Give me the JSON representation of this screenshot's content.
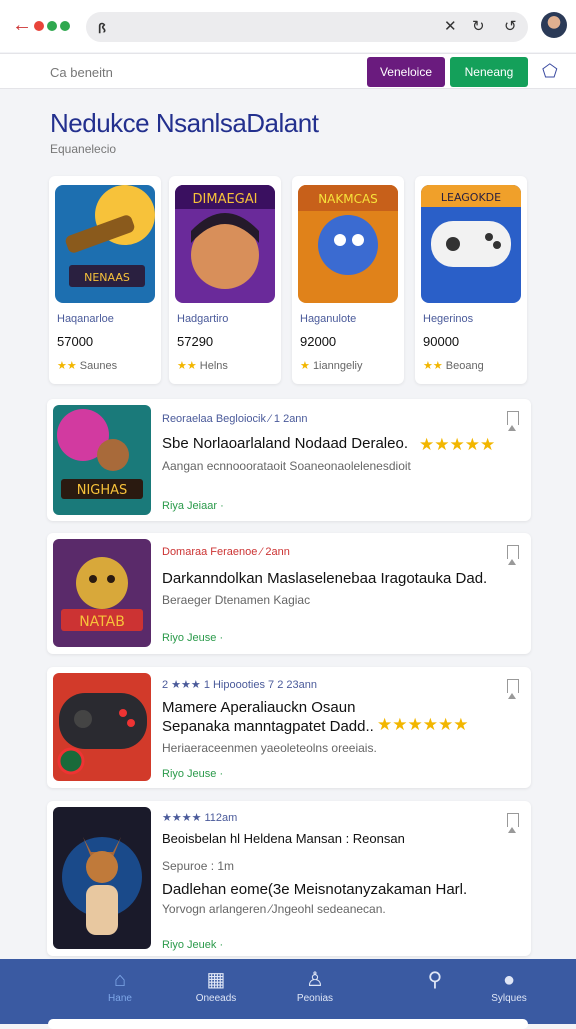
{
  "browser": {
    "url_text": "ꟗ",
    "close_icon": "close-icon",
    "refresh_icon": "refresh-icon",
    "reload_icon": "reload-icon"
  },
  "subbar": {
    "crumb": "Ca beneitn",
    "button1_label": "Veneloice",
    "button1_color": "#6a1b7e",
    "button2_label": "Neneang",
    "button2_color": "#14a05a"
  },
  "page": {
    "title": "Nedukce NsanlsaDalant",
    "subtitle": "Equanelecio"
  },
  "cards": [
    {
      "name": "Haqanarloe",
      "price": "57000",
      "rating": "Saunes",
      "stars": "★★"
    },
    {
      "name": "Hadgartiro",
      "price": "57290",
      "rating": "Helns",
      "stars": "★★"
    },
    {
      "name": "Haganulote",
      "price": "92000",
      "rating": "1ianngeliy",
      "stars": "★"
    },
    {
      "name": "Hegerinos",
      "price": "90000",
      "rating": "Beoang",
      "stars": "★★"
    }
  ],
  "rows": [
    {
      "meta": "Reoraelaa  Begloiocik  ⁄  1  2ann",
      "head": "Sbe Norlaoarlaland Nodaad Deraleo.",
      "head2": "",
      "stars": "★★★★★",
      "desc": "Aangan ecnnooorataoit  Soaneonaolelenesdioit",
      "tag": "Riya Jeiaar  ·"
    },
    {
      "meta": "Domaraa  Feraenoe  ⁄  2ann",
      "head": "Darkanndolkan Maslaselenebaa Iragotauka Dad.",
      "head2": "",
      "stars": "",
      "desc": "Beraeger Dtenamen Kagiac",
      "tag": "Riyo Jeuse  ·"
    },
    {
      "meta": "2 ★★★  1 Hipoooties  7 2  23ann",
      "head": "Mamere Aperaliauckn Osaun",
      "head2": "Sepanaka manntagpatet Dadd..",
      "stars": "★★★★★★",
      "desc": "Heriaeraceenmen yaeoleteolns oreeiais.",
      "tag": "Riyo Jeuse  ·"
    },
    {
      "meta": "★★★★  112am",
      "head": "Beoisbelan  hl Heldena Mansan :  Reonsan",
      "head2": "",
      "stars": "",
      "desc2": "Sepuroe  :  1m",
      "head3": "Dadlehan eome(3e Meisnotanyzakaman Harl.",
      "desc": "Yorvogn arlangeren ⁄Jngeohl sedeanecan.",
      "tag": "Riyo Jeuek  ·"
    }
  ],
  "tabs": [
    {
      "label": "Hane",
      "icon": "home-icon"
    },
    {
      "label": "Oneeads",
      "icon": "grid-icon"
    },
    {
      "label": "Peonias",
      "icon": "user-icon"
    },
    {
      "label": "",
      "icon": "search-icon"
    },
    {
      "label": "Sylques",
      "icon": "profile-icon"
    }
  ],
  "colors": {
    "accent": "#23308e",
    "bottom_bar": "#3a5aa2",
    "star": "#f2b600"
  }
}
